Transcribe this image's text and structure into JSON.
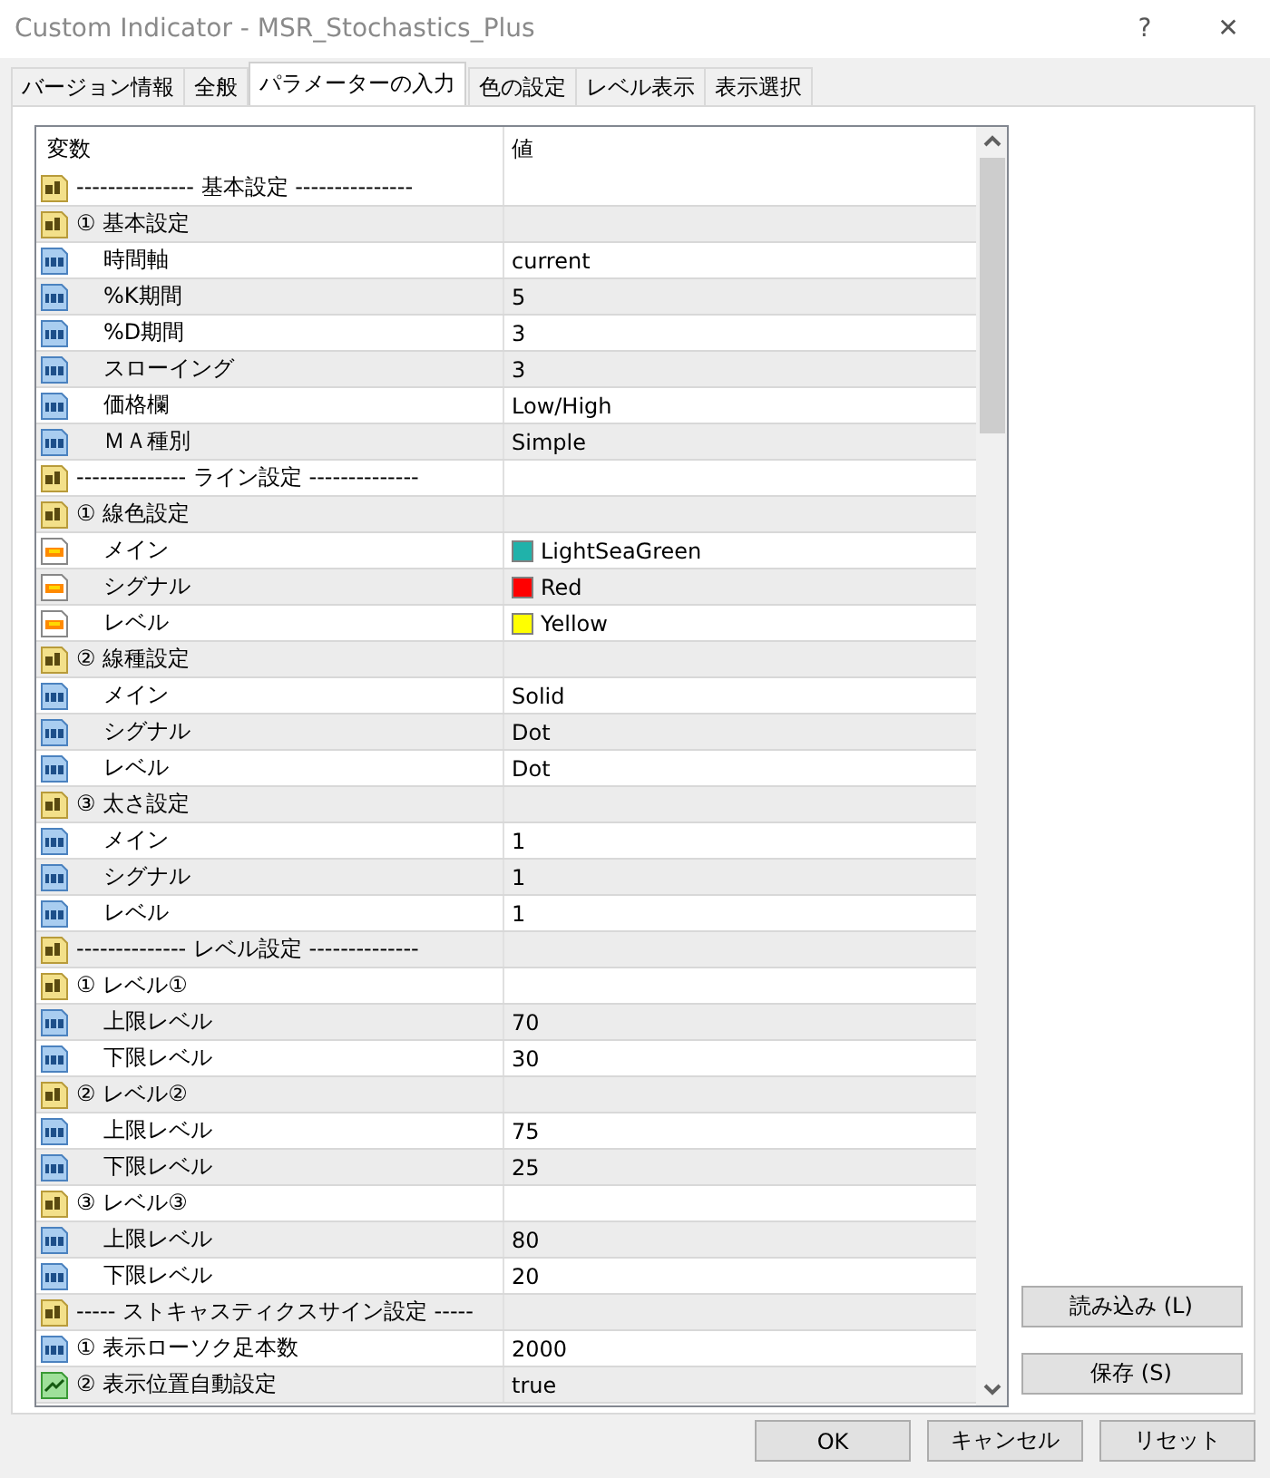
{
  "window": {
    "title": "Custom Indicator - MSR_Stochastics_Plus",
    "help": "?",
    "close": "✕"
  },
  "tabs": [
    {
      "label": "バージョン情報",
      "selected": false
    },
    {
      "label": "全般",
      "selected": false
    },
    {
      "label": "パラメーターの入力",
      "selected": true
    },
    {
      "label": "色の設定",
      "selected": false
    },
    {
      "label": "レベル表示",
      "selected": false
    },
    {
      "label": "表示選択",
      "selected": false
    }
  ],
  "table": {
    "columns": [
      "変数",
      "値"
    ],
    "rows": [
      {
        "kind": "text",
        "name": "--------------- 基本設定 ---------------"
      },
      {
        "kind": "text",
        "name": "① 基本設定",
        "children": [
          {
            "kind": "int",
            "name": "時間軸",
            "value": "current"
          },
          {
            "kind": "int",
            "name": "%K期間",
            "value": "5"
          },
          {
            "kind": "int",
            "name": "%D期間",
            "value": "3"
          },
          {
            "kind": "int",
            "name": "スローイング",
            "value": "3"
          },
          {
            "kind": "int",
            "name": "価格欄",
            "value": "Low/High"
          },
          {
            "kind": "int",
            "name": "ＭＡ種別",
            "value": "Simple"
          }
        ]
      },
      {
        "kind": "text",
        "name": "-------------- ライン設定 --------------"
      },
      {
        "kind": "text",
        "name": "① 線色設定",
        "children": [
          {
            "kind": "color",
            "name": "メイン",
            "value": "LightSeaGreen",
            "color": "#20b2aa"
          },
          {
            "kind": "color",
            "name": "シグナル",
            "value": "Red",
            "color": "#ff0000"
          },
          {
            "kind": "color",
            "name": "レベル",
            "value": "Yellow",
            "color": "#ffff00"
          }
        ]
      },
      {
        "kind": "text",
        "name": "② 線種設定",
        "children": [
          {
            "kind": "int",
            "name": "メイン",
            "value": "Solid"
          },
          {
            "kind": "int",
            "name": "シグナル",
            "value": "Dot"
          },
          {
            "kind": "int",
            "name": "レベル",
            "value": "Dot"
          }
        ]
      },
      {
        "kind": "text",
        "name": "③ 太さ設定",
        "children": [
          {
            "kind": "int",
            "name": "メイン",
            "value": "1"
          },
          {
            "kind": "int",
            "name": "シグナル",
            "value": "1"
          },
          {
            "kind": "int",
            "name": "レベル",
            "value": "1"
          }
        ]
      },
      {
        "kind": "text",
        "name": "-------------- レベル設定 --------------"
      },
      {
        "kind": "text",
        "name": "① レベル①",
        "children": [
          {
            "kind": "int",
            "name": "上限レベル",
            "value": "70"
          },
          {
            "kind": "int",
            "name": "下限レベル",
            "value": "30"
          }
        ]
      },
      {
        "kind": "text",
        "name": "② レベル②",
        "children": [
          {
            "kind": "int",
            "name": "上限レベル",
            "value": "75"
          },
          {
            "kind": "int",
            "name": "下限レベル",
            "value": "25"
          }
        ]
      },
      {
        "kind": "text",
        "name": "③ レベル③",
        "children": [
          {
            "kind": "int",
            "name": "上限レベル",
            "value": "80"
          },
          {
            "kind": "int",
            "name": "下限レベル",
            "value": "20"
          }
        ]
      },
      {
        "kind": "text",
        "name": "----- ストキャスティクスサイン設定 -----"
      },
      {
        "kind": "int",
        "name": "① 表示ローソク足本数",
        "value": "2000"
      },
      {
        "kind": "bool",
        "name": "② 表示位置自動設定",
        "value": "true"
      }
    ]
  },
  "side_buttons": [
    "読み込み (L)",
    "保存 (S)"
  ],
  "buttons": [
    "OK",
    "キャンセル",
    "リセット"
  ]
}
